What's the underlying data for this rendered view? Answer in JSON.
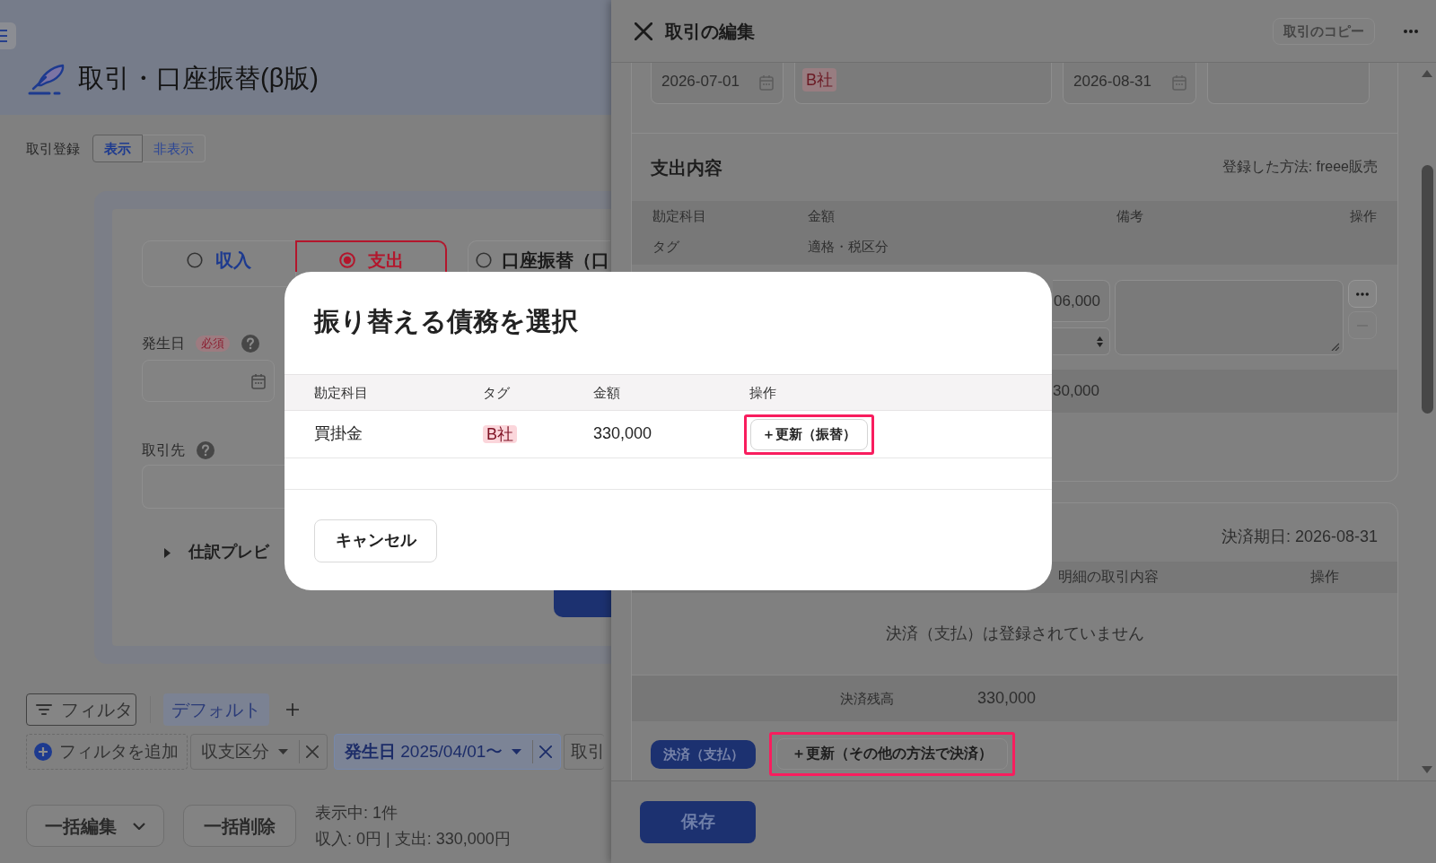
{
  "page": {
    "title": "取引・口座振替(β版)",
    "registration": {
      "label": "取引登録",
      "options": [
        {
          "label": "表示",
          "selected": true
        },
        {
          "label": "非表示",
          "selected": false
        }
      ]
    },
    "form": {
      "types": [
        {
          "label": "収入",
          "selected": false,
          "color": "#1d3a8f"
        },
        {
          "label": "支出",
          "selected": true,
          "color": "#b3162c"
        },
        {
          "label": "口座振替（口",
          "selected": false,
          "color": "#1a1a1a"
        }
      ],
      "date_field": {
        "label": "発生日",
        "badge": "必須"
      },
      "partner_field": {
        "label": "取引先"
      },
      "preview": {
        "label": "仕訳プレビ",
        "expanded": false
      }
    },
    "filters": {
      "filter_button": "フィルタ",
      "preset": "デフォルト",
      "add_filter": "フィルタを追加",
      "chips": [
        {
          "label": "収支区分",
          "active": false
        },
        {
          "label": "**発生日** 2025/04/01〜",
          "active": true
        },
        {
          "label": "取引",
          "active": false
        }
      ]
    },
    "bulk_actions": [
      {
        "kind": "dropdown",
        "label": "一括編集"
      },
      {
        "kind": "button",
        "label": "一括削除"
      }
    ],
    "summary": {
      "count": "表示中: 1件",
      "totals": "収入: 0円 | 支出: 330,000円"
    }
  },
  "drawer": {
    "title": "取引の編集",
    "copy_button": {
      "label": "取引のコピー",
      "disabled": true
    },
    "top_fields": [
      {
        "kind": "date",
        "value": "2026-07-01"
      },
      {
        "kind": "tag",
        "value": "B社"
      },
      {
        "kind": "date",
        "value": "2026-08-31"
      },
      {
        "kind": "text"
      }
    ],
    "expense": {
      "title": "支出内容",
      "source": "登録した方法: freee販売",
      "columns": [
        "勘定科目",
        "金額",
        "備考",
        "操作"
      ],
      "subcolumns": [
        "タグ",
        "適格・税区分"
      ],
      "amount": "06,000",
      "subtotal": "30,000"
    },
    "settlement": {
      "due": "決済期日: 2026-08-31",
      "columns": [
        "明細の取引内容",
        "操作"
      ],
      "empty_message": "決済（支払）は登録されていません",
      "balance_label": "決済残高",
      "balance": "330,000",
      "badge": "決済（支払）",
      "action": {
        "label": "＋更新（その他の方法で決済）",
        "highlighted": true
      }
    },
    "save_button": "保存"
  },
  "modal": {
    "title": "振り替える債務を選択",
    "columns": [
      "勘定科目",
      "タグ",
      "金額",
      "操作"
    ],
    "rows": [
      {
        "account": "買掛金",
        "tag": "B社",
        "amount": "330,000",
        "action": {
          "label": "＋更新（振替）",
          "highlighted": true
        }
      }
    ],
    "cancel_button": "キャンセル"
  }
}
